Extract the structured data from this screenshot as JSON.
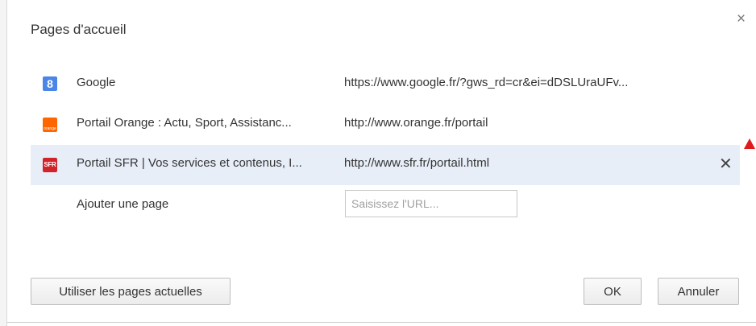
{
  "dialog": {
    "title": "Pages d'accueil",
    "close_symbol": "×"
  },
  "pages": [
    {
      "name": "Google",
      "url": "https://www.google.fr/?gws_rd=cr&ei=dDSLUraUFv...",
      "favicon": "google-favicon",
      "favicon_text": "8",
      "selected": false
    },
    {
      "name": "Portail Orange : Actu, Sport, Assistanc...",
      "url": "http://www.orange.fr/portail",
      "favicon": "orange-favicon",
      "favicon_text": "orange",
      "selected": false
    },
    {
      "name": "Portail SFR | Vos services et contenus, I...",
      "url": "http://www.sfr.fr/portail.html",
      "favicon": "sfr-favicon",
      "favicon_text": "SFR",
      "selected": true
    }
  ],
  "remove_symbol": "✕",
  "add_page": {
    "label": "Ajouter une page",
    "placeholder": "Saisissez l'URL..."
  },
  "buttons": {
    "use_current": "Utiliser les pages actuelles",
    "ok": "OK",
    "cancel": "Annuler"
  },
  "colors": {
    "selected_row": "#e8eef8",
    "google_blue": "#4a86e8",
    "orange_brand": "#ff6600",
    "sfr_red": "#d2232a",
    "annotation_arrow": "#e01b1b"
  }
}
